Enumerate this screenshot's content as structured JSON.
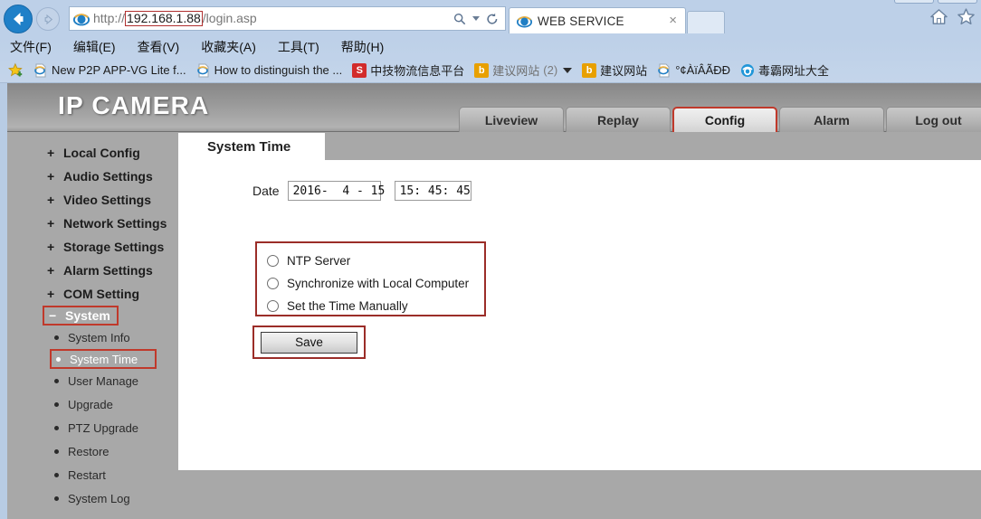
{
  "browser": {
    "back_icon": "back-arrow-icon",
    "forward_icon": "forward-arrow-icon",
    "url": {
      "scheme": "http://",
      "host": "192.168.1.88",
      "path": "/login.asp"
    },
    "search_icon": "search-icon",
    "refresh_icon": "refresh-icon",
    "tab": {
      "title": "WEB SERVICE",
      "close_label": "×",
      "favicon": "internet-explorer-icon"
    },
    "home_icon": "home-icon",
    "favorites_icon": "favorites-star-icon",
    "menu": [
      {
        "label": "文件(F)"
      },
      {
        "label": "编辑(E)"
      },
      {
        "label": "查看(V)"
      },
      {
        "label": "收藏夹(A)"
      },
      {
        "label": "工具(T)"
      },
      {
        "label": "帮助(H)"
      }
    ],
    "favorites": [
      {
        "label": "New P2P APP-VG Lite f...",
        "icon": "ie-page-icon",
        "count": ""
      },
      {
        "label": "How to distinguish the ...",
        "icon": "ie-page-icon",
        "count": ""
      },
      {
        "label": "中技物流信息平台",
        "icon": "sogou-icon",
        "icon_text": "S",
        "icon_color": "#d22b2b",
        "count": ""
      },
      {
        "label": "建议网站",
        "icon": "bing-icon",
        "icon_text": "b",
        "icon_color": "#e8a000",
        "count": "(2)",
        "has_caret": true
      },
      {
        "label": "建议网站",
        "icon": "bing-icon",
        "icon_text": "b",
        "icon_color": "#e8a000",
        "count": ""
      },
      {
        "label": "°¢ÀïÂÃÐÐ",
        "icon": "ie-page-icon",
        "count": ""
      },
      {
        "label": "毒霸网址大全",
        "icon": "duba-icon",
        "count": ""
      }
    ]
  },
  "app": {
    "brand": "IP CAMERA",
    "accent_color": "#c0392b",
    "nav_tabs": [
      {
        "label": "Liveview",
        "active": false
      },
      {
        "label": "Replay",
        "active": false
      },
      {
        "label": "Config",
        "active": true
      },
      {
        "label": "Alarm",
        "active": false
      },
      {
        "label": "Log out",
        "active": false
      }
    ],
    "sidebar": {
      "groups": [
        {
          "label": "Local Config",
          "sign": "+",
          "selected": false
        },
        {
          "label": "Audio Settings",
          "sign": "+",
          "selected": false
        },
        {
          "label": "Video Settings",
          "sign": "+",
          "selected": false
        },
        {
          "label": "Network Settings",
          "sign": "+",
          "selected": false
        },
        {
          "label": "Storage Settings",
          "sign": "+",
          "selected": false
        },
        {
          "label": "Alarm Settings",
          "sign": "+",
          "selected": false
        },
        {
          "label": "COM Setting",
          "sign": "+",
          "selected": false
        },
        {
          "label": "System",
          "sign": "−",
          "selected": true
        }
      ],
      "sub_items": [
        {
          "label": "System Info",
          "selected": false
        },
        {
          "label": "System Time",
          "selected": true
        },
        {
          "label": "User Manage",
          "selected": false
        },
        {
          "label": "Upgrade",
          "selected": false
        },
        {
          "label": "PTZ Upgrade",
          "selected": false
        },
        {
          "label": "Restore",
          "selected": false
        },
        {
          "label": "Restart",
          "selected": false
        },
        {
          "label": "System Log",
          "selected": false
        }
      ]
    },
    "panel": {
      "title": "System Time",
      "date_label": "Date",
      "date_value": "2016-  4 - 15",
      "time_value": "15: 45: 45",
      "time_options": [
        {
          "label": "NTP Server",
          "checked": false
        },
        {
          "label": "Synchronize with Local Computer",
          "checked": false
        },
        {
          "label": "Set the Time Manually",
          "checked": false
        }
      ],
      "save_label": "Save"
    }
  }
}
